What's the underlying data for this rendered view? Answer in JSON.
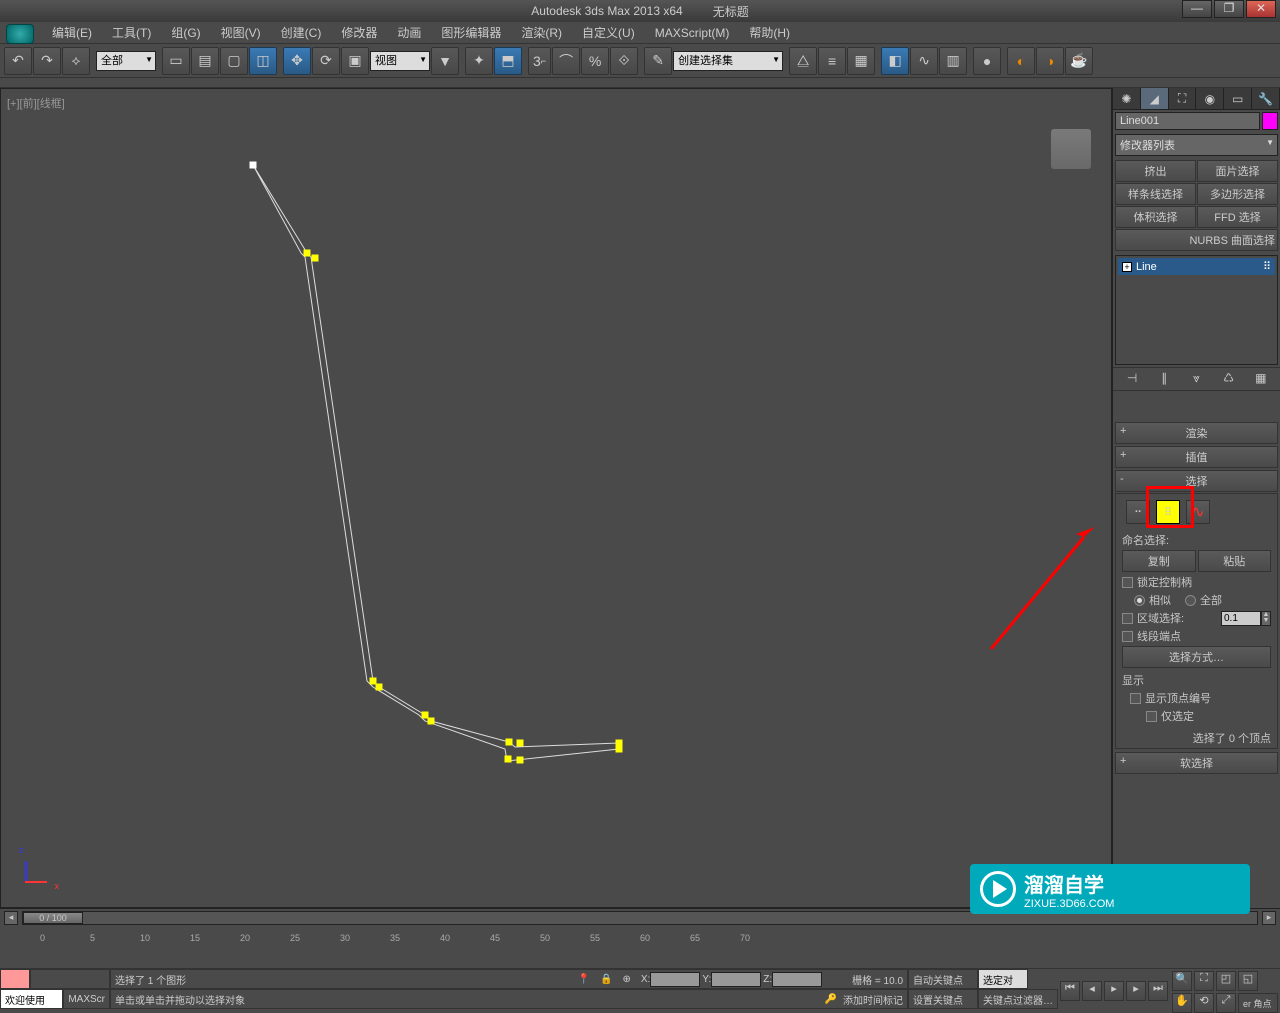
{
  "titlebar": {
    "app_title": "Autodesk 3ds Max  2013 x64",
    "doc_title": "无标题",
    "minimize": "—",
    "maximize": "❐",
    "close": "✕"
  },
  "menubar": {
    "items": [
      "编辑(E)",
      "工具(T)",
      "组(G)",
      "视图(V)",
      "创建(C)",
      "修改器",
      "动画",
      "图形编辑器",
      "渲染(R)",
      "自定义(U)",
      "MAXScript(M)",
      "帮助(H)"
    ]
  },
  "toolbar": {
    "filter_combo": "全部",
    "view_combo": "视图",
    "named_sel_combo": "创建选择集",
    "snap_label": "3"
  },
  "viewport": {
    "label": "[+][前][线框]",
    "axis_z": "z",
    "axis_x": "x"
  },
  "command_panel": {
    "object_name": "Line001",
    "modifier_list": "修改器列表",
    "quick_buttons": [
      "挤出",
      "面片选择",
      "样条线选择",
      "多边形选择",
      "体积选择",
      "FFD 选择"
    ],
    "nurbs_label": "NURBS 曲面选择",
    "stack_item": "Line",
    "rollouts": {
      "render": "渲染",
      "interp": "插值",
      "selection": "选择",
      "soft_sel": "软选择"
    },
    "named_sel_label": "命名选择:",
    "copy_btn": "复制",
    "paste_btn": "粘贴",
    "lock_handles": "锁定控制柄",
    "similar": "相似",
    "all": "全部",
    "area_sel": "区域选择:",
    "area_val": "0.1",
    "seg_end": "线段端点",
    "sel_method": "选择方式…",
    "display_hdr": "显示",
    "show_vert_num": "显示顶点编号",
    "only_sel": "仅选定",
    "sel_count": "选择了 0 个顶点"
  },
  "timeline": {
    "slider_text": "0 / 100",
    "ticks": [
      "0",
      "5",
      "10",
      "15",
      "20",
      "25",
      "30",
      "35",
      "40",
      "45",
      "50",
      "55",
      "60",
      "65",
      "70"
    ]
  },
  "statusbar": {
    "welcome": "欢迎使用",
    "maxscript": "MAXScr",
    "sel_info": "选择了 1 个图形",
    "prompt": "单击或单击并拖动以选择对象",
    "x_label": "X:",
    "y_label": "Y:",
    "z_label": "Z:",
    "grid_label": "栅格 = 10.0",
    "auto_key": "自动关键点",
    "set_key": "设置关键点",
    "sel_set": "选定对",
    "key_filter": "关键点过滤器…",
    "add_time_tag": "添加时间标记",
    "corner": "er 角点"
  },
  "watermark": {
    "brand": "溜溜自学",
    "url": "ZIXUE.3D66.COM"
  }
}
